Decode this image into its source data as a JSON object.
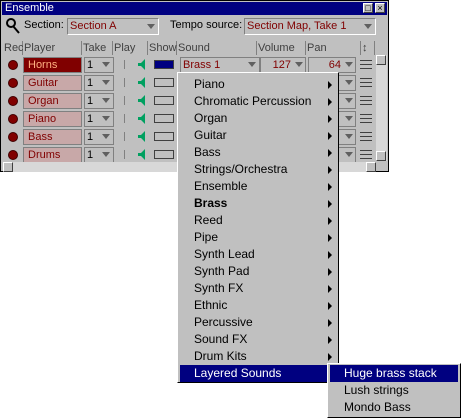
{
  "window": {
    "title": "Ensemble"
  },
  "toolbar": {
    "section_label": "Section:",
    "section_value": "Section A",
    "tempo_label": "Tempo source:",
    "tempo_value": "Section Map, Take 1"
  },
  "columns": [
    "Rec",
    "Player",
    "Take",
    "Play",
    "Show",
    "Sound",
    "Volume",
    "Pan",
    "↕"
  ],
  "rows": [
    {
      "player": "Horns",
      "take": "1",
      "sound": "Brass 1",
      "volume": "127",
      "pan": "64",
      "selected": true,
      "show_color": "#000080"
    },
    {
      "player": "Guitar",
      "take": "1",
      "sound": "",
      "volume": "",
      "pan": "",
      "selected": false,
      "show_color": "#c0c0c0"
    },
    {
      "player": "Organ",
      "take": "1",
      "sound": "",
      "volume": "",
      "pan": "",
      "selected": false,
      "show_color": "#c0c0c0"
    },
    {
      "player": "Piano",
      "take": "1",
      "sound": "",
      "volume": "",
      "pan": "",
      "selected": false,
      "show_color": "#c0c0c0"
    },
    {
      "player": "Bass",
      "take": "1",
      "sound": "",
      "volume": "",
      "pan": "",
      "selected": false,
      "show_color": "#c0c0c0"
    },
    {
      "player": "Drums",
      "take": "1",
      "sound": "",
      "volume": "",
      "pan": "",
      "selected": false,
      "show_color": "#c0c0c0"
    }
  ],
  "sound_menu": {
    "items": [
      {
        "label": "Piano",
        "bold": false,
        "highlighted": false
      },
      {
        "label": "Chromatic Percussion",
        "bold": false,
        "highlighted": false
      },
      {
        "label": "Organ",
        "bold": false,
        "highlighted": false
      },
      {
        "label": "Guitar",
        "bold": false,
        "highlighted": false
      },
      {
        "label": "Bass",
        "bold": false,
        "highlighted": false
      },
      {
        "label": "Strings/Orchestra",
        "bold": false,
        "highlighted": false
      },
      {
        "label": "Ensemble",
        "bold": false,
        "highlighted": false
      },
      {
        "label": "Brass",
        "bold": true,
        "highlighted": false
      },
      {
        "label": "Reed",
        "bold": false,
        "highlighted": false
      },
      {
        "label": "Pipe",
        "bold": false,
        "highlighted": false
      },
      {
        "label": "Synth Lead",
        "bold": false,
        "highlighted": false
      },
      {
        "label": "Synth Pad",
        "bold": false,
        "highlighted": false
      },
      {
        "label": "Synth FX",
        "bold": false,
        "highlighted": false
      },
      {
        "label": "Ethnic",
        "bold": false,
        "highlighted": false
      },
      {
        "label": "Percussive",
        "bold": false,
        "highlighted": false
      },
      {
        "label": "Sound FX",
        "bold": false,
        "highlighted": false
      },
      {
        "label": "Drum Kits",
        "bold": false,
        "highlighted": false
      },
      {
        "label": "Layered Sounds",
        "bold": false,
        "highlighted": true
      }
    ]
  },
  "layered_submenu": {
    "items": [
      {
        "label": "Huge brass stack",
        "highlighted": true
      },
      {
        "label": "Lush strings",
        "highlighted": false
      },
      {
        "label": "Mondo Bass",
        "highlighted": false
      }
    ]
  },
  "colors": {
    "title_bar": "#000080",
    "text_accent": "#800000",
    "highlight": "#000080",
    "speaker": "#00a060"
  }
}
